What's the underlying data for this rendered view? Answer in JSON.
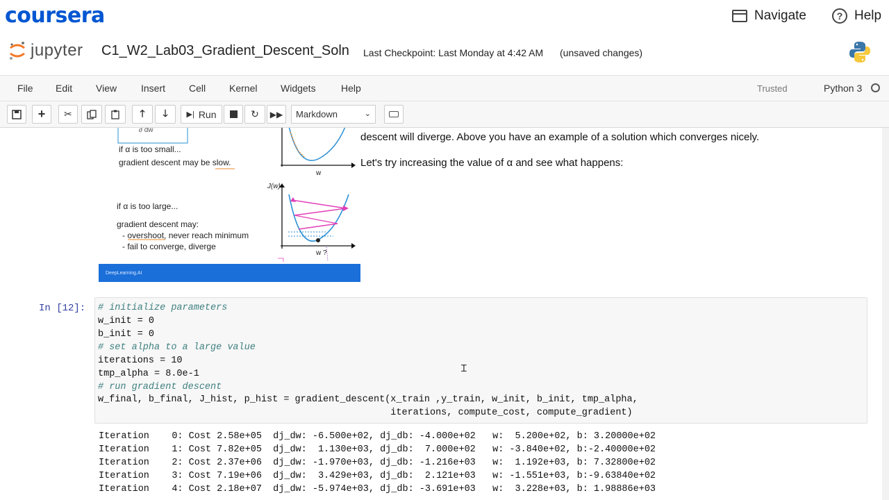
{
  "coursera": {
    "logo": "coursera",
    "navigate_label": "Navigate",
    "help_label": "Help",
    "help_glyph": "?"
  },
  "jupyter": {
    "logo_text": "jupyter",
    "notebook_title": "C1_W2_Lab03_Gradient_Descent_Soln",
    "checkpoint": "Last Checkpoint: Last Monday at 4:42 AM",
    "unsaved": "(unsaved changes)"
  },
  "menu": {
    "items": [
      "File",
      "Edit",
      "View",
      "Insert",
      "Cell",
      "Kernel",
      "Widgets",
      "Help"
    ],
    "trusted": "Trusted",
    "kernel": "Python 3"
  },
  "toolbar": {
    "run_label": "Run",
    "cell_type": "Markdown"
  },
  "markdown": {
    "line1": "descent will diverge. Above you have an example of a solution which converges nicely.",
    "line2": "Let's try increasing the value of α and see what happens:"
  },
  "figure": {
    "small_title": "if α is too small...",
    "small_desc": "gradient descent may be slow.",
    "large_title": "if α is too large...",
    "large_desc1": "gradient descent may:",
    "large_desc2": "- overshoot, never reach minimum",
    "large_desc3": "- fail to converge, diverge",
    "axis_w1": "w",
    "axis_jw": "J(w)",
    "axis_w2": "w ?",
    "banner": "DeepLearning.AI"
  },
  "cell": {
    "prompt": "In [12]:",
    "lines": [
      "# initialize parameters",
      "w_init = 0",
      "b_init = 0",
      "# set alpha to a large value",
      "iterations = 10",
      "tmp_alpha = 8.0e-1",
      "# run gradient descent",
      "w_final, b_final, J_hist, p_hist = gradient_descent(x_train ,y_train, w_init, b_init, tmp_alpha,",
      "                                                    iterations, compute_cost, compute_gradient)"
    ]
  },
  "output": {
    "lines": [
      "Iteration    0: Cost 2.58e+05  dj_dw: -6.500e+02, dj_db: -4.000e+02   w:  5.200e+02, b: 3.20000e+02",
      "Iteration    1: Cost 7.82e+05  dj_dw:  1.130e+03, dj_db:  7.000e+02   w: -3.840e+02, b:-2.40000e+02",
      "Iteration    2: Cost 2.37e+06  dj_dw: -1.970e+03, dj_db: -1.216e+03   w:  1.192e+03, b: 7.32800e+02",
      "Iteration    3: Cost 7.19e+06  dj_dw:  3.429e+03, dj_db:  2.121e+03   w: -1.551e+03, b:-9.63840e+02",
      "Iteration    4: Cost 2.18e+07  dj_dw: -5.974e+03, dj_db: -3.691e+03   w:  3.228e+03, b: 1.98886e+03"
    ]
  },
  "colors": {
    "coursera_blue": "#0056D2",
    "jupyter_orange": "#F37726",
    "banner_blue": "#1a6fd9"
  }
}
